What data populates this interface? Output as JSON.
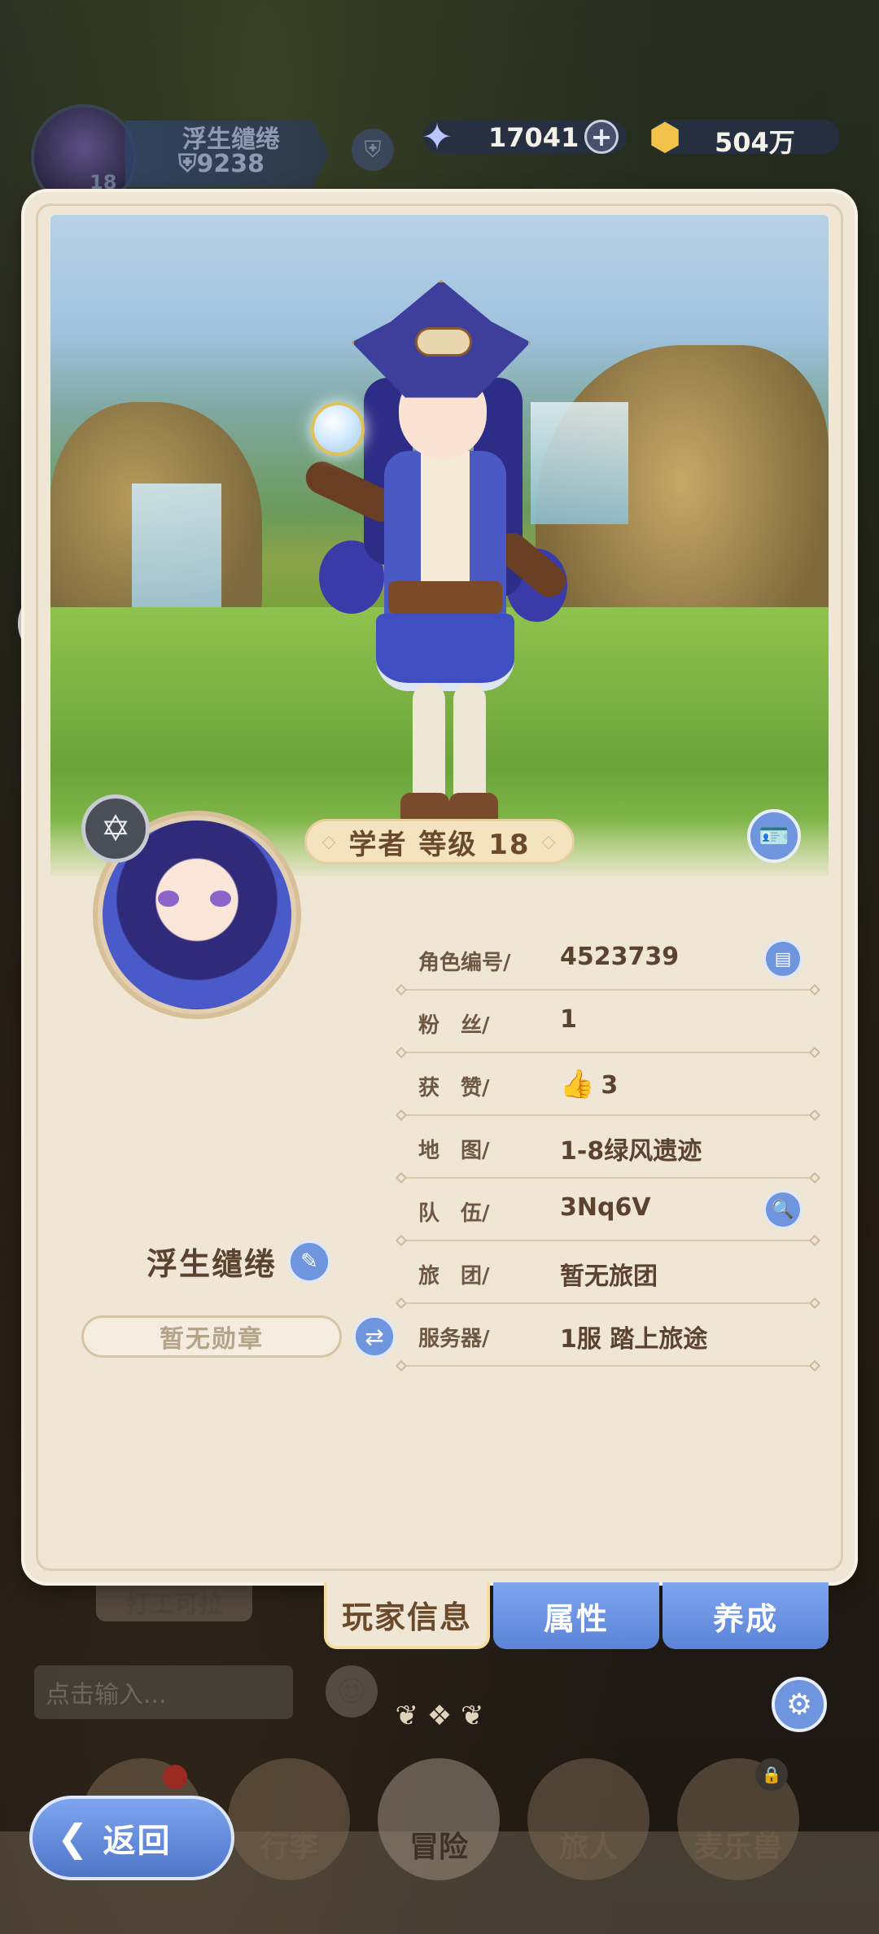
{
  "hud": {
    "player_name": "浮生缱绻",
    "power": "9238",
    "level": "18",
    "gems": "17041",
    "gold": "504万"
  },
  "card": {
    "class_level": "学者 等级 18",
    "player_name": "浮生缱绻",
    "badge": "暂无勋章",
    "info": [
      {
        "label": "角色编号/",
        "value": "4523739"
      },
      {
        "label": "粉　丝/",
        "value": "1"
      },
      {
        "label": "获　赞/",
        "value": "3"
      },
      {
        "label": "地　图/",
        "value": "1-8绿风遗迹"
      },
      {
        "label": "队　伍/",
        "value": "3Nq6V"
      },
      {
        "label": "旅　团/",
        "value": "暂无旅团"
      },
      {
        "label": "服务器/",
        "value": "1服  踏上旅途"
      }
    ]
  },
  "tabs": [
    "玩家信息",
    "属性",
    "养成"
  ],
  "background": {
    "work_button": "打工可拉",
    "chat_placeholder": "点击输入...",
    "nav": [
      "行李",
      "冒险",
      "旅人",
      "麦乐兽"
    ]
  },
  "back_label": "返回",
  "colors": {
    "accent_blue": "#6f95de",
    "card_bg": "#efe6d6",
    "text_brown": "#5c4330"
  }
}
